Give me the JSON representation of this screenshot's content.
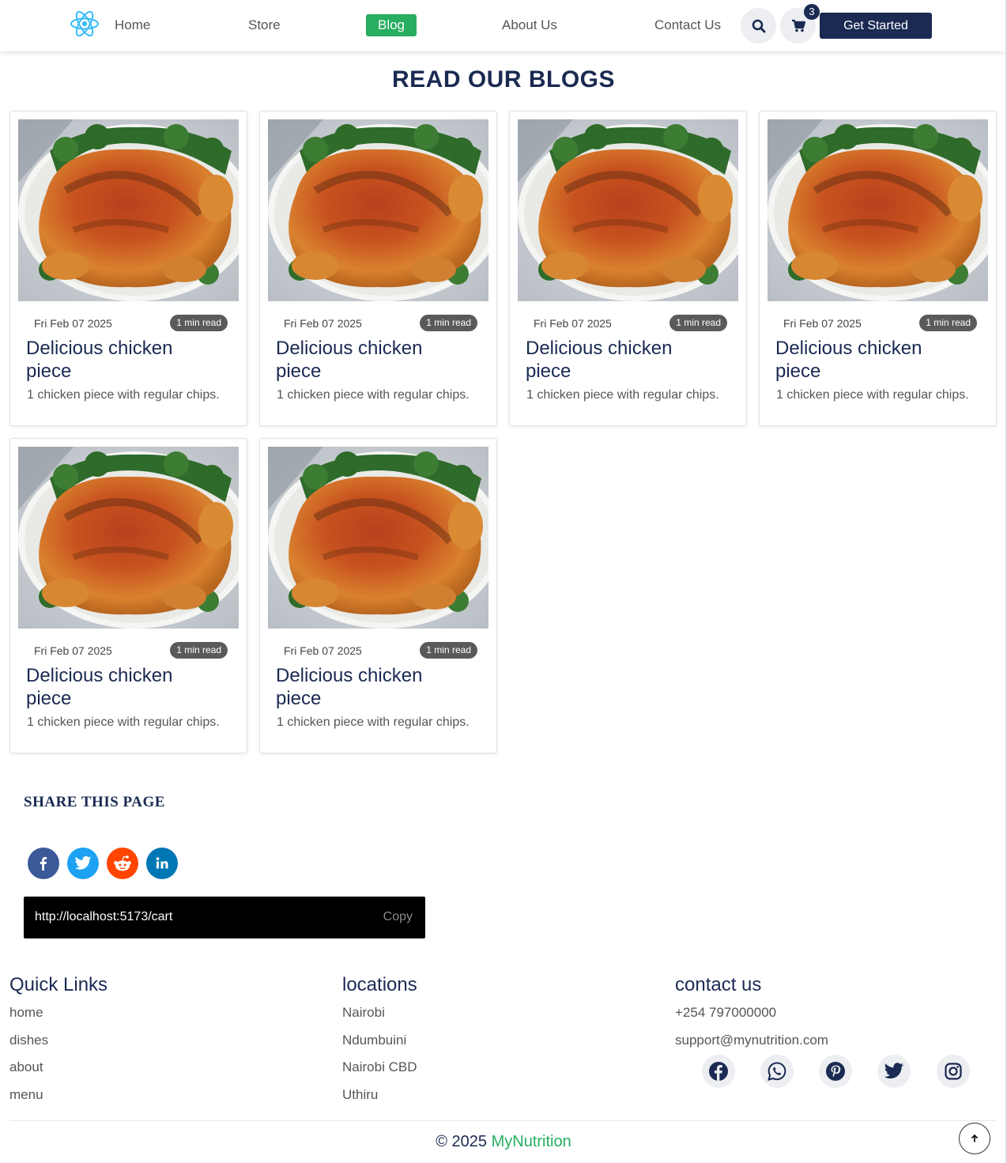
{
  "nav": {
    "links": [
      "Home",
      "Store",
      "Blog",
      "About Us",
      "Contact Us"
    ],
    "active": "Blog",
    "cart_count": "3",
    "cta": "Get Started",
    "icons": {
      "logo": "react-atom-icon",
      "search": "search-icon",
      "cart": "cart-icon"
    },
    "colors": {
      "primary": "#1a2a52",
      "accent": "#27ae60",
      "logo": "#38bdf8"
    }
  },
  "page_title": "READ OUR BLOGS",
  "blogs": [
    {
      "date": "Fri Feb 07 2025",
      "read_time": "1 min read",
      "title": "Delicious chicken piece",
      "description": "1 chicken piece with regular chips."
    },
    {
      "date": "Fri Feb 07 2025",
      "read_time": "1 min read",
      "title": "Delicious chicken piece",
      "description": "1 chicken piece with regular chips."
    },
    {
      "date": "Fri Feb 07 2025",
      "read_time": "1 min read",
      "title": "Delicious chicken piece",
      "description": "1 chicken piece with regular chips."
    },
    {
      "date": "Fri Feb 07 2025",
      "read_time": "1 min read",
      "title": "Delicious chicken piece",
      "description": "1 chicken piece with regular chips."
    },
    {
      "date": "Fri Feb 07 2025",
      "read_time": "1 min read",
      "title": "Delicious chicken piece",
      "description": "1 chicken piece with regular chips."
    },
    {
      "date": "Fri Feb 07 2025",
      "read_time": "1 min read",
      "title": "Delicious chicken piece",
      "description": "1 chicken piece with regular chips."
    }
  ],
  "share": {
    "title": "SHARE THIS PAGE",
    "networks": [
      {
        "icon": "facebook-icon",
        "color": "#3b5998"
      },
      {
        "icon": "twitter-icon",
        "color": "#1da1f2"
      },
      {
        "icon": "reddit-icon",
        "color": "#ff4500"
      },
      {
        "icon": "linkedin-icon",
        "color": "#0077b5"
      }
    ],
    "url": "http://localhost:5173/cart",
    "copy_label": "Copy"
  },
  "footer": {
    "quick_links": {
      "title": "Quick Links",
      "items": [
        "home",
        "dishes",
        "about",
        "menu"
      ]
    },
    "locations": {
      "title": "locations",
      "items": [
        "Nairobi",
        "Ndumbuini",
        "Nairobi CBD",
        "Uthiru"
      ]
    },
    "contact": {
      "title": "contact us",
      "phone": "+254 797000000",
      "email": "support@mynutrition.com",
      "socials": [
        "facebook-icon",
        "whatsapp-icon",
        "pinterest-icon",
        "twitter-icon",
        "instagram-icon"
      ]
    },
    "copyright_prefix": "© 2025",
    "brand": "MyNutrition"
  }
}
